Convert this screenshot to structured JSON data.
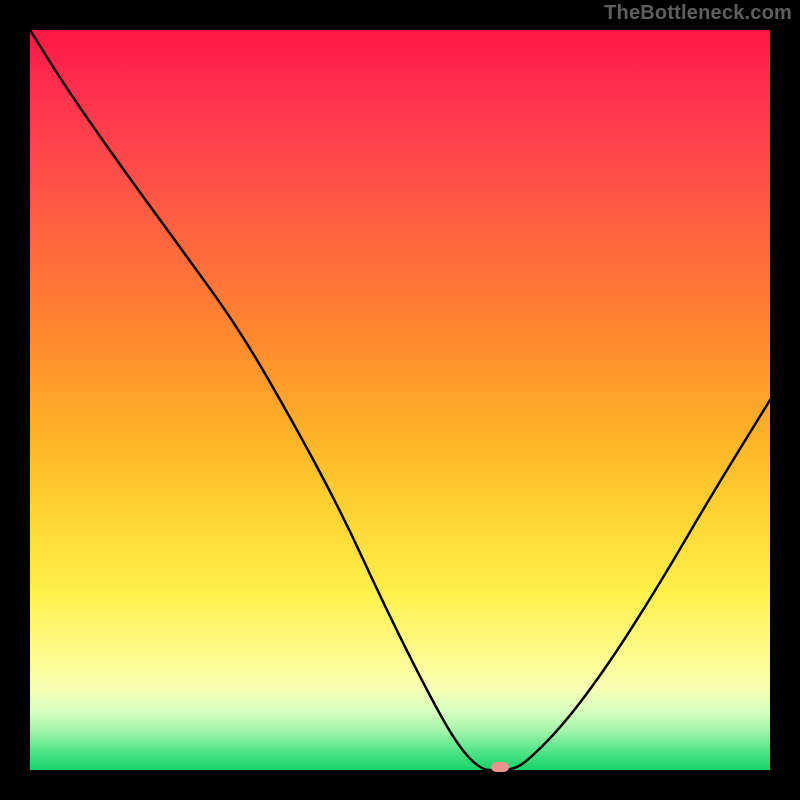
{
  "watermark": "TheBottleneck.com",
  "chart_data": {
    "type": "line",
    "title": "",
    "xlabel": "",
    "ylabel": "",
    "xlim": [
      0,
      100
    ],
    "ylim": [
      0,
      100
    ],
    "grid": false,
    "legend": false,
    "background": "gradient-red-to-green",
    "series": [
      {
        "name": "bottleneck-curve",
        "x": [
          0,
          5,
          12,
          20,
          28,
          35,
          42,
          48,
          54,
          58,
          61,
          63,
          65,
          67,
          72,
          78,
          85,
          92,
          100
        ],
        "values": [
          100,
          92,
          82,
          71,
          60,
          48,
          35,
          22,
          10,
          3,
          0,
          0,
          0,
          1,
          6,
          14,
          25,
          37,
          50
        ]
      }
    ],
    "marker": {
      "x": 63.5,
      "y": 0,
      "color": "#e8948d"
    },
    "gradient_stops": [
      {
        "pos": 0,
        "color": "#ff1744"
      },
      {
        "pos": 0.3,
        "color": "#ff6a3c"
      },
      {
        "pos": 0.55,
        "color": "#ffb327"
      },
      {
        "pos": 0.76,
        "color": "#fff04a"
      },
      {
        "pos": 0.92,
        "color": "#d8ffc0"
      },
      {
        "pos": 1.0,
        "color": "#17d36a"
      }
    ]
  }
}
